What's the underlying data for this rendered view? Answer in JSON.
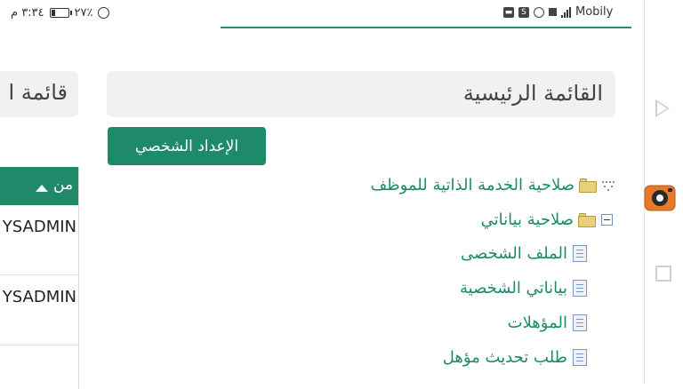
{
  "status_bar": {
    "time": "٣:٣٤ م",
    "battery": "٢٧٪",
    "battery_level": 0.27,
    "carrier": "Mobily",
    "notif_s": "S"
  },
  "side_panel": {
    "title": "قائمة ا",
    "table_header": "من",
    "rows": [
      "YSADMIN",
      "YSADMIN"
    ]
  },
  "main": {
    "menu_title": "القائمة الرئيسية",
    "profile_button": "الإعداد الشخصي",
    "tree": {
      "root": "صلاحية الخدمة الذاتية للموظف",
      "group": "صلاحية بياناتي",
      "items": [
        "الملف الشخصى",
        "بياناتي الشخصية",
        "المؤهلات",
        "طلب تحديث مؤهل"
      ]
    }
  },
  "colors": {
    "accent": "#1f8a6a",
    "panel": "#f1f1f1"
  }
}
